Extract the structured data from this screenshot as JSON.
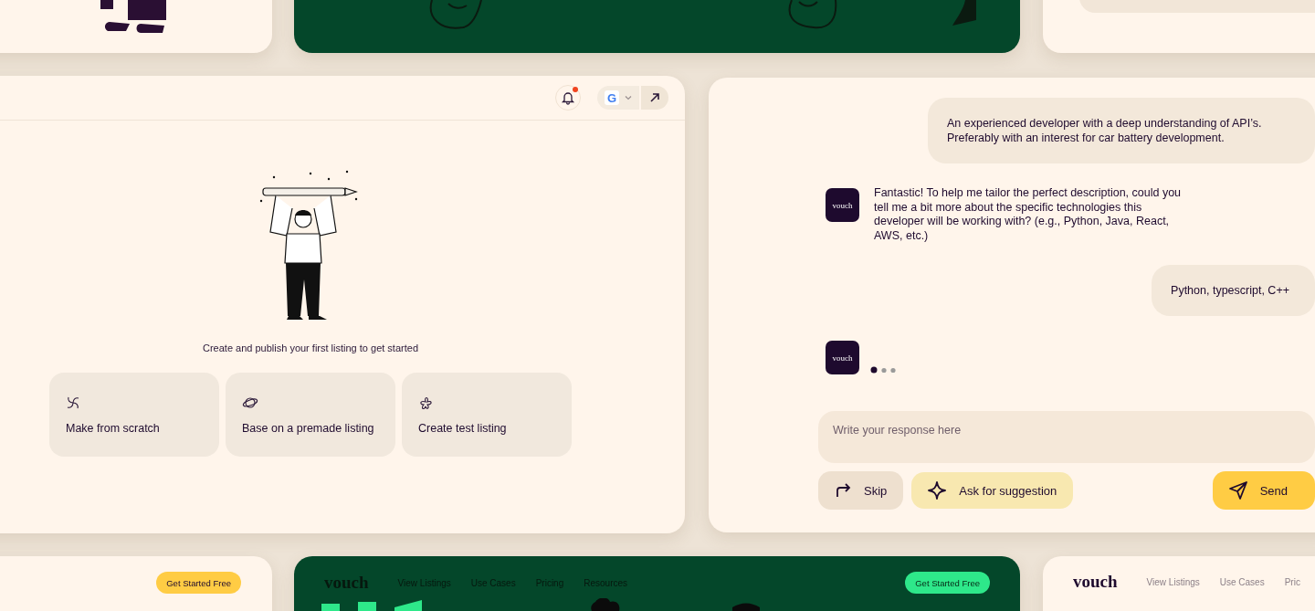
{
  "listing_panel": {
    "notification": {
      "unread": true
    },
    "account_badge": "G",
    "heading": "Create and publish your first listing to get started",
    "options": [
      {
        "label": "Make from scratch",
        "kind": "spiral"
      },
      {
        "label": "Base on a premade listing",
        "kind": "planet"
      },
      {
        "label": "Create test listing",
        "kind": "flower"
      }
    ]
  },
  "chat": {
    "messages": [
      {
        "kind": "user",
        "text": "An experienced developer with a deep understanding of API’s. Preferably with an interest for car battery development."
      },
      {
        "kind": "bot",
        "avatar": "vouch",
        "text": "Fantastic! To help me tailor the perfect description, could you tell me a bit more about the specific technologies this developer will be working with? (e.g., Python, Java, React, AWS, etc.)"
      },
      {
        "kind": "user",
        "text": "Python, typescript, C++"
      },
      {
        "kind": "bot",
        "avatar": "vouch",
        "typing": true
      }
    ],
    "input": {
      "placeholder": "Write your response here"
    },
    "actions": [
      {
        "label": "Skip",
        "kind": "skip"
      },
      {
        "label": "Ask for suggestion",
        "kind": "suggest"
      },
      {
        "label": "Send",
        "kind": "send"
      }
    ]
  },
  "bottom_left": {
    "cta": "Get Started Free"
  },
  "bottom_middle": {
    "logo": "vouch",
    "nav": [
      "View Listings",
      "Use Cases",
      "Pricing",
      "Resources"
    ],
    "cta": "Get Started Free"
  },
  "bottom_right": {
    "logo": "vouch",
    "nav": [
      "View Listings",
      "Use Cases",
      "Pric"
    ]
  }
}
